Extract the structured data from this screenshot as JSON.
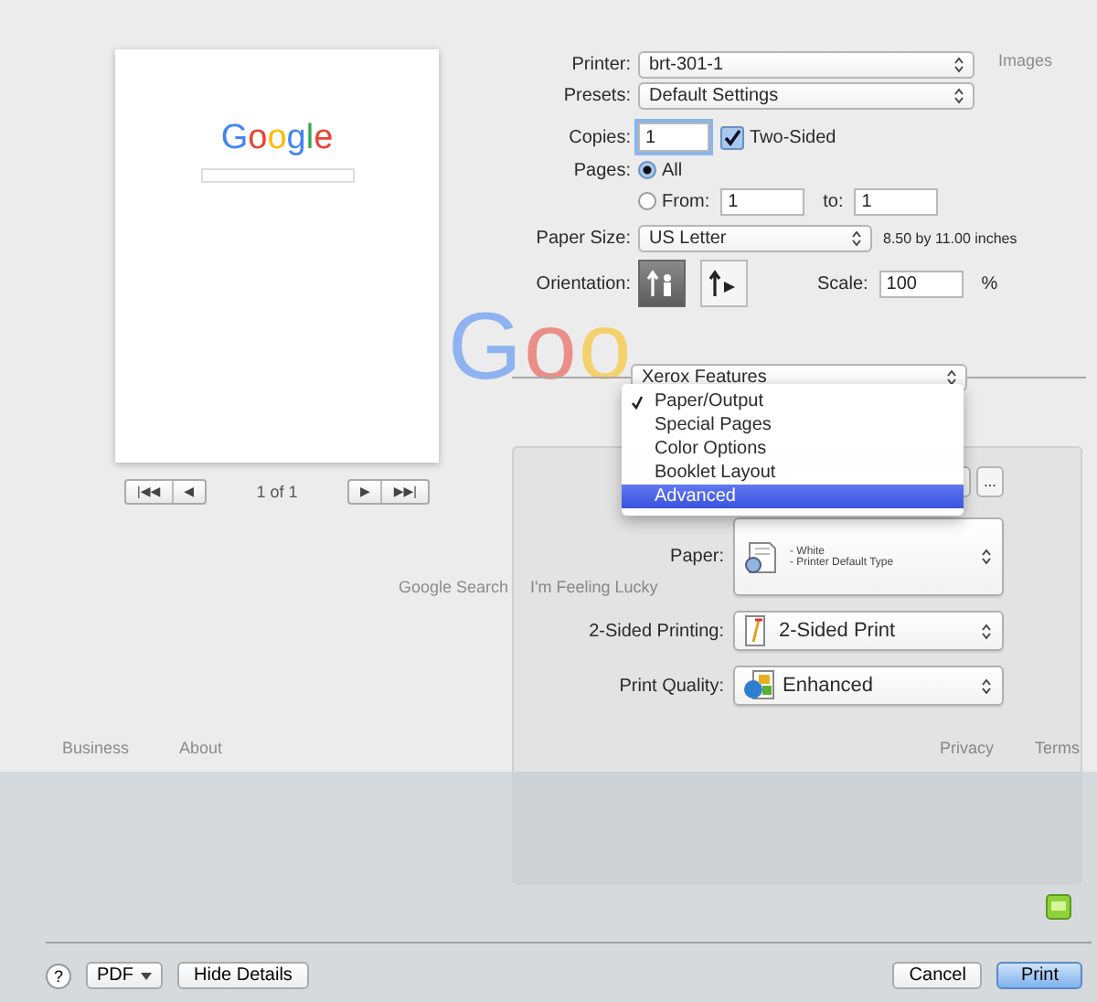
{
  "background": {
    "logo": "Goo",
    "top_link": "Images",
    "search_buttons": [
      "Google Search",
      "I'm Feeling Lucky"
    ],
    "footer_left": [
      "Business",
      "About"
    ],
    "footer_right": [
      "Privacy",
      "Terms"
    ]
  },
  "preview": {
    "logo": "Google",
    "nav_left": [
      "|◀◀",
      "◀"
    ],
    "page": "1 of 1",
    "nav_right": [
      "▶",
      "▶▶|"
    ]
  },
  "printer": {
    "label": "Printer:",
    "value": "brt-301-1"
  },
  "presets": {
    "label": "Presets:",
    "value": "Default Settings"
  },
  "copies": {
    "label": "Copies:",
    "value": "1"
  },
  "two_sided": {
    "label": "Two-Sided",
    "checked": true
  },
  "pages": {
    "label": "Pages:",
    "options": [
      {
        "label": "All",
        "selected": true
      },
      {
        "label": "From:",
        "selected": false
      }
    ],
    "from": "1",
    "to_label": "to:",
    "to": "1"
  },
  "paper_size": {
    "label": "Paper Size:",
    "value": "US Letter",
    "dimensions": "8.50 by 11.00 inches"
  },
  "orientation": {
    "label": "Orientation:",
    "options": [
      {
        "kind": "portrait",
        "selected": true
      },
      {
        "kind": "landscape",
        "selected": false
      }
    ]
  },
  "scale": {
    "label": "Scale:",
    "value": "100",
    "unit": "%"
  },
  "section_popup": {
    "value": "Xerox Features"
  },
  "menu": {
    "items": [
      {
        "label": "Paper/Output",
        "checked": true,
        "selected": false
      },
      {
        "label": "Special Pages",
        "checked": false,
        "selected": false
      },
      {
        "label": "Color Options",
        "checked": false,
        "selected": false
      },
      {
        "label": "Booklet Layout",
        "checked": false,
        "selected": false
      },
      {
        "label": "Advanced",
        "checked": false,
        "selected": true
      }
    ]
  },
  "panel": {
    "more": "...",
    "paper": {
      "label": "Paper:",
      "lines": [
        "- White",
        "- Printer Default Type"
      ]
    },
    "two_sided_printing": {
      "label": "2-Sided Printing:",
      "value": "2-Sided Print"
    },
    "print_quality": {
      "label": "Print Quality:",
      "value": "Enhanced"
    }
  },
  "buttons": {
    "help": "?",
    "pdf": "PDF",
    "hide_details": "Hide Details",
    "cancel": "Cancel",
    "print": "Print"
  }
}
